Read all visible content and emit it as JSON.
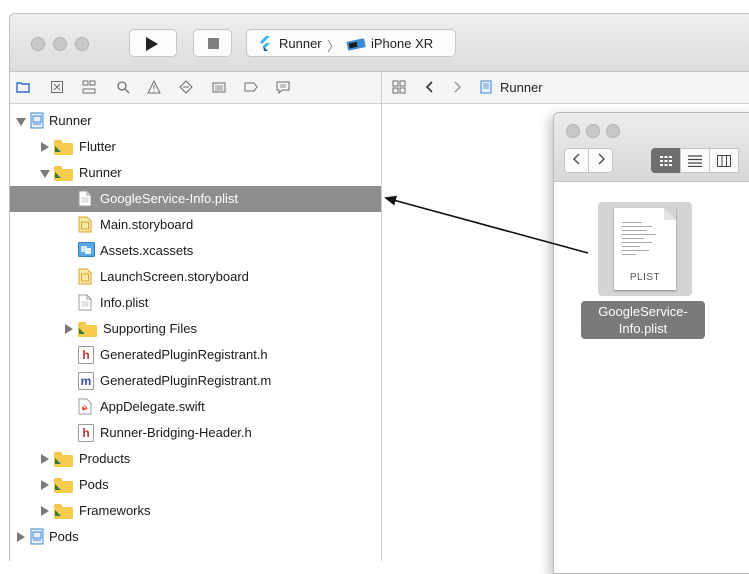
{
  "xcode": {
    "scheme": {
      "target": "Runner",
      "device": "iPhone XR"
    },
    "jump_bar": {
      "item": "Runner"
    },
    "navigator_tabs": [
      "folder-icon",
      "source-control-icon",
      "hierarchy-icon",
      "search-icon",
      "warning-icon",
      "test-icon",
      "debug-icon",
      "breakpoint-icon",
      "report-icon"
    ],
    "tree": [
      {
        "label": "Runner",
        "indent": 0,
        "disclosure": "open",
        "icon": "project-icon",
        "selected": false
      },
      {
        "label": "Flutter",
        "indent": 1,
        "disclosure": "closed",
        "icon": "folder-icon",
        "selected": false
      },
      {
        "label": "Runner",
        "indent": 1,
        "disclosure": "open",
        "icon": "folder-icon",
        "selected": false
      },
      {
        "label": "GoogleService-Info.plist",
        "indent": 2,
        "disclosure": "none",
        "icon": "plist-file-icon",
        "selected": true
      },
      {
        "label": "Main.storyboard",
        "indent": 2,
        "disclosure": "none",
        "icon": "storyboard-icon",
        "selected": false
      },
      {
        "label": "Assets.xcassets",
        "indent": 2,
        "disclosure": "none",
        "icon": "asset-catalog-icon",
        "selected": false
      },
      {
        "label": "LaunchScreen.storyboard",
        "indent": 2,
        "disclosure": "none",
        "icon": "storyboard-icon",
        "selected": false
      },
      {
        "label": "Info.plist",
        "indent": 2,
        "disclosure": "none",
        "icon": "plist-file-icon",
        "selected": false
      },
      {
        "label": "Supporting Files",
        "indent": 2,
        "disclosure": "closed",
        "icon": "folder-icon",
        "selected": false
      },
      {
        "label": "GeneratedPluginRegistrant.h",
        "indent": 2,
        "disclosure": "none",
        "icon": "header-file-icon",
        "selected": false
      },
      {
        "label": "GeneratedPluginRegistrant.m",
        "indent": 2,
        "disclosure": "none",
        "icon": "objc-file-icon",
        "selected": false
      },
      {
        "label": "AppDelegate.swift",
        "indent": 2,
        "disclosure": "none",
        "icon": "swift-file-icon",
        "selected": false
      },
      {
        "label": "Runner-Bridging-Header.h",
        "indent": 2,
        "disclosure": "none",
        "icon": "header-file-icon",
        "selected": false
      },
      {
        "label": "Products",
        "indent": 1,
        "disclosure": "closed",
        "icon": "folder-icon",
        "selected": false
      },
      {
        "label": "Pods",
        "indent": 1,
        "disclosure": "closed",
        "icon": "folder-icon",
        "selected": false
      },
      {
        "label": "Frameworks",
        "indent": 1,
        "disclosure": "closed",
        "icon": "folder-icon",
        "selected": false
      },
      {
        "label": "Pods",
        "indent": 0,
        "disclosure": "closed",
        "icon": "project-icon",
        "selected": false
      }
    ]
  },
  "finder": {
    "file": {
      "type_label": "PLIST",
      "name_line1": "GoogleService-",
      "name_line2": "Info.plist"
    }
  },
  "colors": {
    "selection": "#8e8e8e",
    "folder": "#f7cb4d",
    "arrow": "#111111"
  }
}
